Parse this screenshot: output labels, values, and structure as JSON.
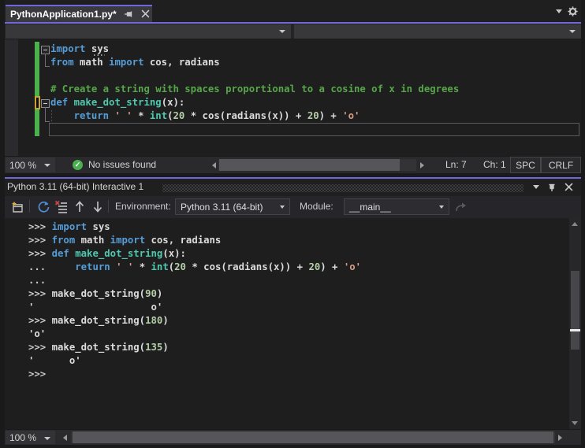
{
  "accent_color": "#6F67DA",
  "editor": {
    "tab_title": "PythonApplication1.py*",
    "code_lines": [
      [
        [
          "kw",
          "import"
        ],
        [
          "id",
          " sys"
        ]
      ],
      [
        [
          "kw",
          "from"
        ],
        [
          "id",
          " math "
        ],
        [
          "kw",
          "import"
        ],
        [
          "id",
          " cos, radians"
        ]
      ],
      [],
      [
        [
          "com",
          "# Create a string with spaces proportional to a cosine of x in degrees"
        ]
      ],
      [
        [
          "kw",
          "def"
        ],
        [
          "id",
          " "
        ],
        [
          "fn",
          "make_dot_string"
        ],
        [
          "id",
          "(x):"
        ]
      ],
      [
        [
          "id",
          "    "
        ],
        [
          "kw",
          "return"
        ],
        [
          "id",
          " "
        ],
        [
          "str",
          "' '"
        ],
        [
          "id",
          " * "
        ],
        [
          "fn",
          "int"
        ],
        [
          "id",
          "("
        ],
        [
          "num",
          "20"
        ],
        [
          "id",
          " * cos(radians(x)) + "
        ],
        [
          "num",
          "20"
        ],
        [
          "id",
          ") + "
        ],
        [
          "str",
          "'o'"
        ]
      ],
      []
    ],
    "status": {
      "zoom": "100 %",
      "issues": "No issues found",
      "line": "Ln: 7",
      "column": "Ch: 1",
      "spaces": "SPC",
      "line_ending": "CRLF"
    }
  },
  "interactive": {
    "title": "Python 3.11 (64-bit) Interactive 1",
    "env_label": "Environment:",
    "env_value": "Python 3.11 (64-bit)",
    "module_label": "Module:",
    "module_value": "__main__",
    "zoom": "100 %",
    "lines": [
      [
        [
          "pr",
          ">>> "
        ],
        [
          "kw",
          "import"
        ],
        [
          "id",
          " sys"
        ]
      ],
      [
        [
          "pr",
          ">>> "
        ],
        [
          "kw",
          "from"
        ],
        [
          "id",
          " math "
        ],
        [
          "kw",
          "import"
        ],
        [
          "id",
          " cos, radians"
        ]
      ],
      [
        [
          "pr",
          ">>> "
        ],
        [
          "kw",
          "def"
        ],
        [
          "id",
          " "
        ],
        [
          "fn",
          "make_dot_string"
        ],
        [
          "id",
          "(x):"
        ]
      ],
      [
        [
          "pr",
          "... "
        ],
        [
          "id",
          "    "
        ],
        [
          "kw",
          "return"
        ],
        [
          "id",
          " "
        ],
        [
          "str",
          "' '"
        ],
        [
          "id",
          " * "
        ],
        [
          "fn",
          "int"
        ],
        [
          "id",
          "("
        ],
        [
          "num",
          "20"
        ],
        [
          "id",
          " * cos(radians(x)) + "
        ],
        [
          "num",
          "20"
        ],
        [
          "id",
          ") + "
        ],
        [
          "str",
          "'o'"
        ]
      ],
      [
        [
          "pr",
          "..."
        ]
      ],
      [
        [
          "pr",
          ">>> "
        ],
        [
          "id",
          "make_dot_string("
        ],
        [
          "num",
          "90"
        ],
        [
          "id",
          ")"
        ]
      ],
      [
        [
          "id",
          "'                    o'"
        ]
      ],
      [
        [
          "pr",
          ">>> "
        ],
        [
          "id",
          "make_dot_string("
        ],
        [
          "num",
          "180"
        ],
        [
          "id",
          ")"
        ]
      ],
      [
        [
          "id",
          "'o'"
        ]
      ],
      [
        [
          "pr",
          ">>> "
        ],
        [
          "id",
          "make_dot_string("
        ],
        [
          "num",
          "135"
        ],
        [
          "id",
          ")"
        ]
      ],
      [
        [
          "id",
          "'      o'"
        ]
      ],
      [
        [
          "pr",
          ">>>"
        ]
      ]
    ]
  }
}
